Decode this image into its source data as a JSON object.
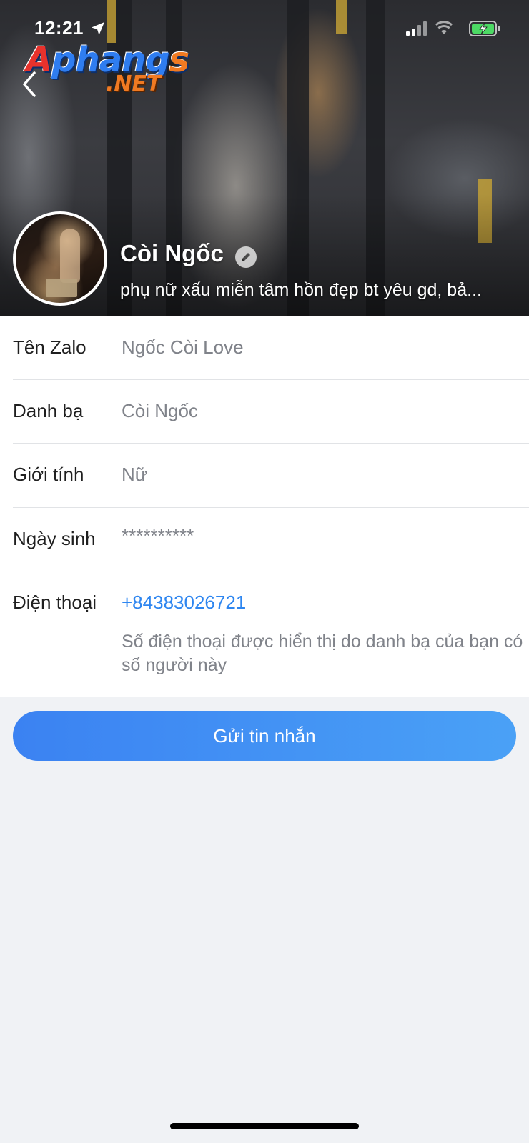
{
  "status_bar": {
    "time": "12:21",
    "icons": [
      "location-arrow-icon",
      "signal-bars-icon",
      "wifi-icon",
      "battery-charging-icon"
    ]
  },
  "watermark": {
    "main": "Aphangs",
    "sub": ".NET"
  },
  "profile": {
    "name": "Còi Ngốc",
    "status": "phụ nữ xấu miễn tâm hồn đẹp bt yêu gd, bả..."
  },
  "info": {
    "rows": [
      {
        "label": "Tên Zalo",
        "value": "Ngốc Còi Love"
      },
      {
        "label": "Danh bạ",
        "value": "Còi Ngốc"
      },
      {
        "label": "Giới tính",
        "value": "Nữ"
      },
      {
        "label": "Ngày sinh",
        "value": "**********"
      },
      {
        "label": "Điện thoại",
        "value": "+84383026721",
        "note": "Số điện thoại được hiển thị do danh bạ của bạn có số người này"
      }
    ]
  },
  "actions": {
    "send_message": "Gửi tin nhắn"
  },
  "colors": {
    "accent": "#2e86f0",
    "button_start": "#3b82f2",
    "button_end": "#4aa1f6",
    "background": "#f0f2f5"
  }
}
